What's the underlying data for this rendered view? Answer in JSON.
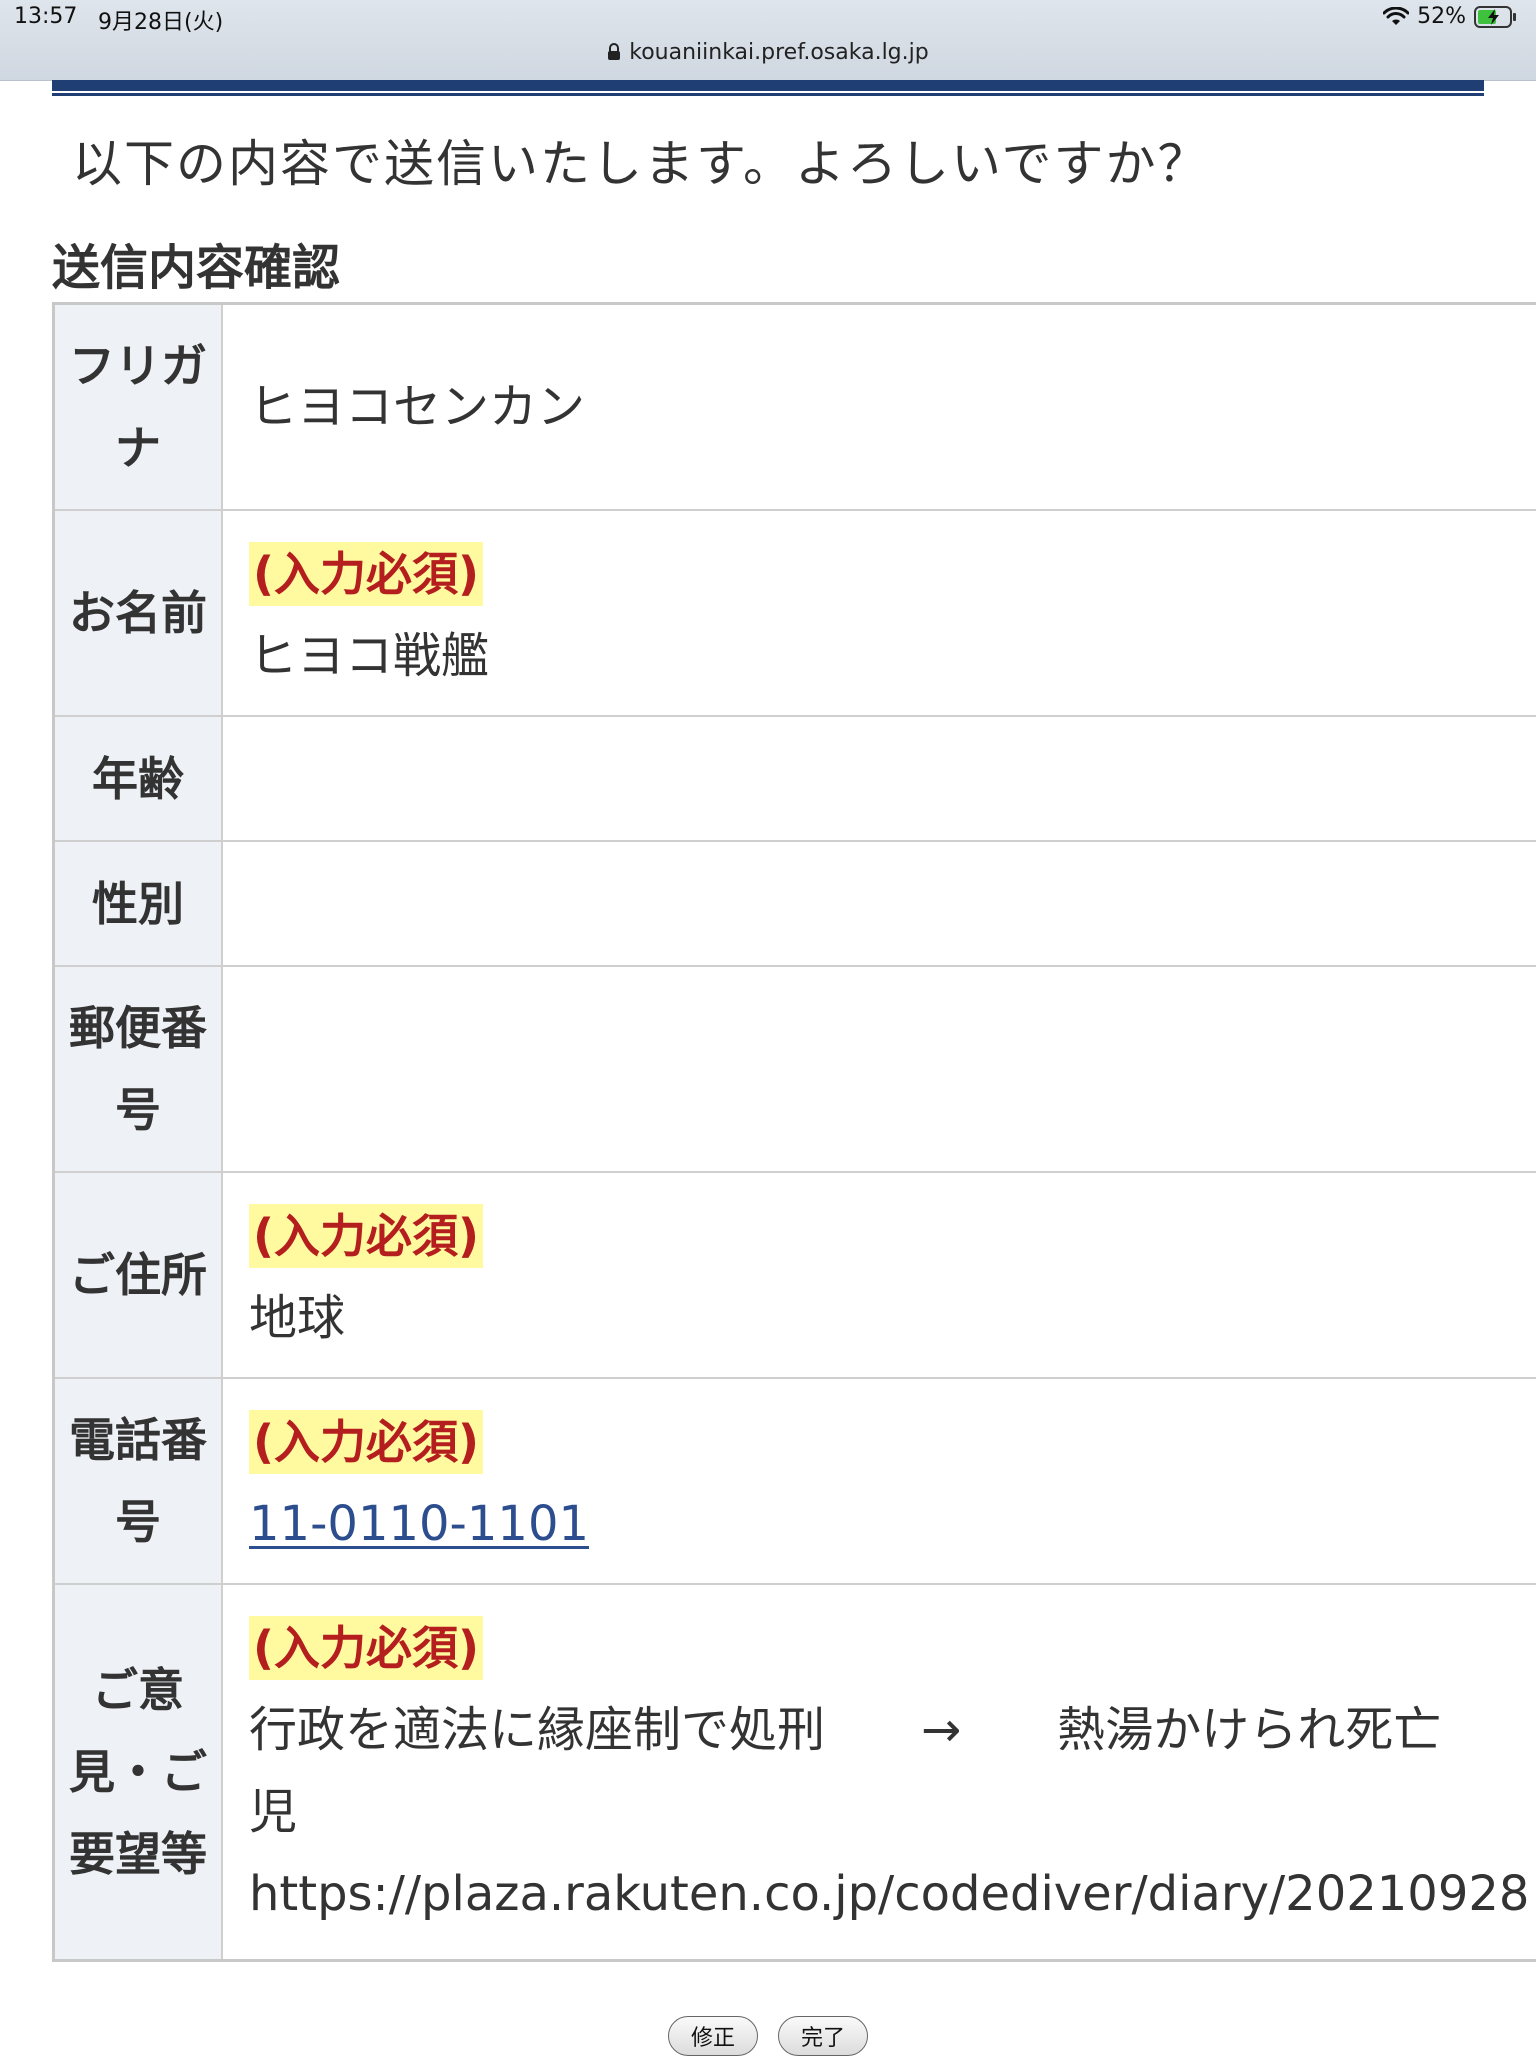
{
  "status_bar": {
    "time": "13:57",
    "date": "9月28日(火)",
    "battery": "52%",
    "wifi_icon": "wifi-icon",
    "battery_icon": "battery-charging-icon"
  },
  "browser": {
    "url": "kouaniinkai.pref.osaka.lg.jp",
    "lock_icon": "lock-icon"
  },
  "page": {
    "confirm_message": "以下の内容で送信いたします。よろしいですか？",
    "section_title": "送信内容確認"
  },
  "form": {
    "required_label": "(入力必須)",
    "rows": [
      {
        "label": "フリガナ",
        "value": "ヒヨコセンカン"
      },
      {
        "label": "お名前",
        "value": "ヒヨコ戦艦"
      },
      {
        "label": "年齢",
        "value": ""
      },
      {
        "label": "性別",
        "value": ""
      },
      {
        "label": "郵便番号",
        "value": ""
      },
      {
        "label": "ご住所",
        "value": "地球"
      },
      {
        "label": "電話番号",
        "value": "11-0110-1101"
      },
      {
        "label": "ご意見・ご要望等",
        "value_lines": [
          "行政を適法に縁座制で処刑　　→　　熱湯かけられ死亡",
          "児",
          "https://plaza.rakuten.co.jp/codediver/diary/20210928"
        ]
      }
    ]
  },
  "buttons": {
    "correct": "修正",
    "complete": "完了"
  },
  "colors": {
    "header_rule": "#1f3e74",
    "required_bg": "#fffaa0",
    "required_text": "#b41e1e",
    "th_bg": "#eef1f6",
    "link": "#2c4d8e"
  }
}
